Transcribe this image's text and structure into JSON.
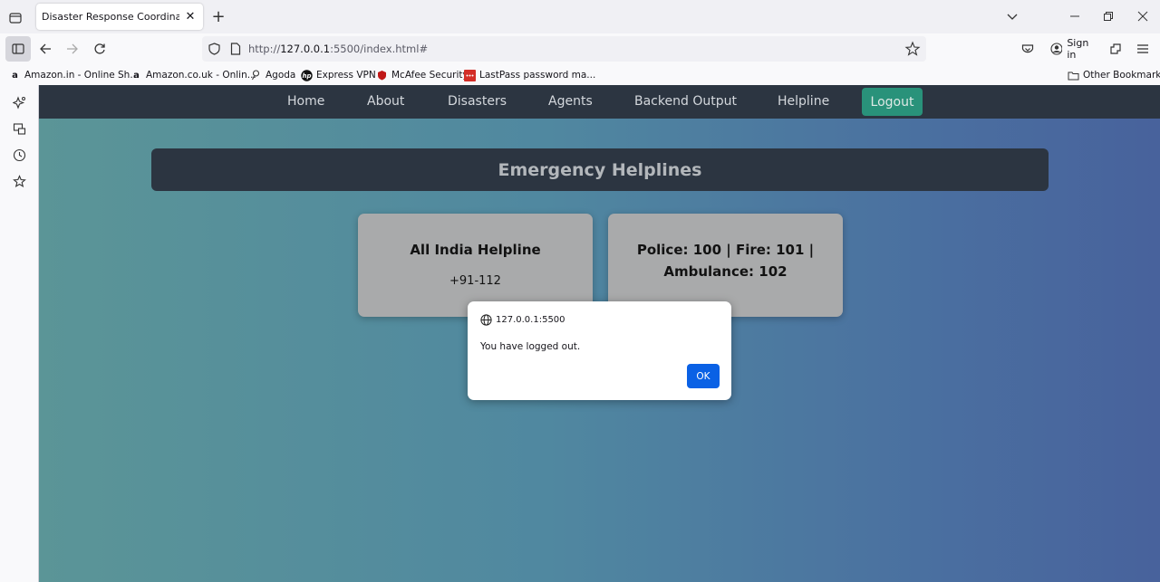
{
  "browser": {
    "tab": {
      "title": "Disaster Response Coordination System"
    },
    "url": {
      "prefix": "http://",
      "host": "127.0.0.1",
      "rest": ":5500/index.html#"
    },
    "signin_label": "Sign in",
    "bookmarks": [
      {
        "label": "Amazon.in - Online Sh...",
        "icon": "amazon-icon"
      },
      {
        "label": "Amazon.co.uk - Onlin...",
        "icon": "amazon-icon"
      },
      {
        "label": "Agoda",
        "icon": "agoda-icon"
      },
      {
        "label": "Express VPN",
        "icon": "hp-icon"
      },
      {
        "label": "McAfee Security",
        "icon": "mcafee-icon"
      },
      {
        "label": "LastPass password ma...",
        "icon": "lastpass-icon"
      }
    ],
    "other_bookmarks": "Other Bookmarks"
  },
  "site": {
    "nav": [
      {
        "label": "Home"
      },
      {
        "label": "About"
      },
      {
        "label": "Disasters"
      },
      {
        "label": "Agents"
      },
      {
        "label": "Backend Output"
      },
      {
        "label": "Helpline"
      }
    ],
    "logout_label": "Logout",
    "heading": "Emergency Helplines",
    "cards": [
      {
        "title": "All India Helpline",
        "value": "+91-112"
      },
      {
        "title": "Police: 100 | Fire: 101 | Ambulance: 102",
        "value": ""
      }
    ]
  },
  "dialog": {
    "origin": "127.0.0.1:5500",
    "message": "You have logged out.",
    "ok_label": "OK"
  },
  "colors": {
    "nav_bg": "#2c3541",
    "logout_bg": "#29927a",
    "card_bg": "#a9aaab",
    "ok_bg": "#0a61e5"
  }
}
